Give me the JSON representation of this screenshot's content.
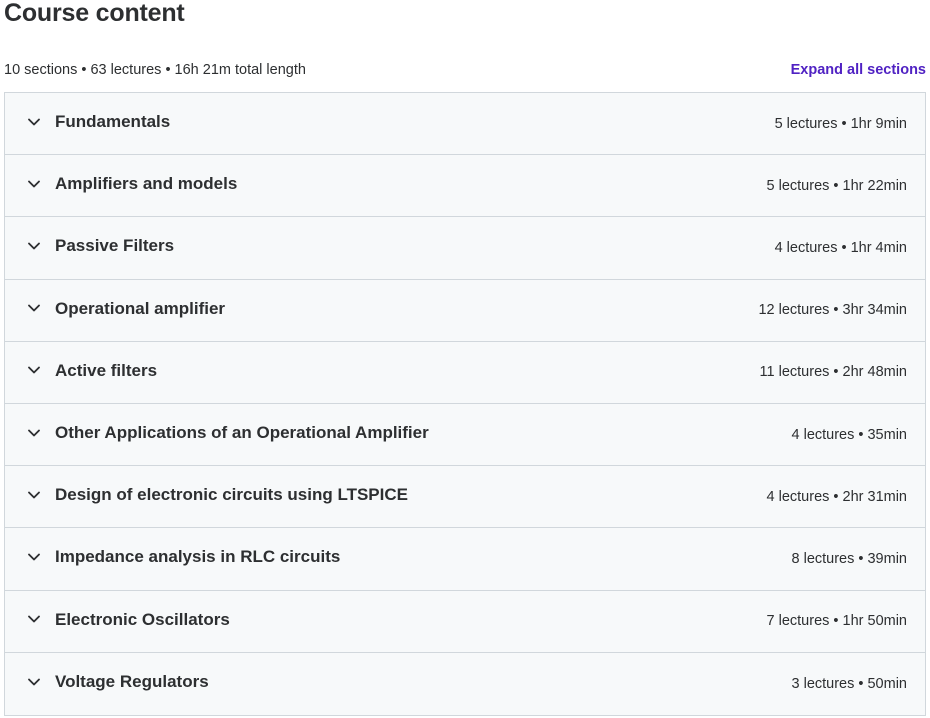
{
  "header": {
    "title": "Course content",
    "summary": "10 sections • 63 lectures • 16h 21m total length",
    "expand_all_label": "Expand all sections"
  },
  "colors": {
    "accent": "#5022c3",
    "section_bg": "#f7f9fa",
    "border": "#d1d7dc",
    "text": "#2d2f31"
  },
  "icons": {
    "section_toggle": "chevron-down-icon"
  },
  "sections": [
    {
      "title": "Fundamentals",
      "meta": "5 lectures • 1hr 9min"
    },
    {
      "title": "Amplifiers and models",
      "meta": "5 lectures • 1hr 22min"
    },
    {
      "title": "Passive Filters",
      "meta": "4 lectures • 1hr 4min"
    },
    {
      "title": "Operational amplifier",
      "meta": "12 lectures • 3hr 34min"
    },
    {
      "title": "Active filters",
      "meta": "11 lectures • 2hr 48min"
    },
    {
      "title": "Other Applications of an Operational Amplifier",
      "meta": "4 lectures • 35min"
    },
    {
      "title": "Design of electronic circuits using LTSPICE",
      "meta": "4 lectures • 2hr 31min"
    },
    {
      "title": "Impedance analysis in RLC circuits",
      "meta": "8 lectures • 39min"
    },
    {
      "title": "Electronic Oscillators",
      "meta": "7 lectures • 1hr 50min"
    },
    {
      "title": "Voltage Regulators",
      "meta": "3 lectures • 50min"
    }
  ]
}
